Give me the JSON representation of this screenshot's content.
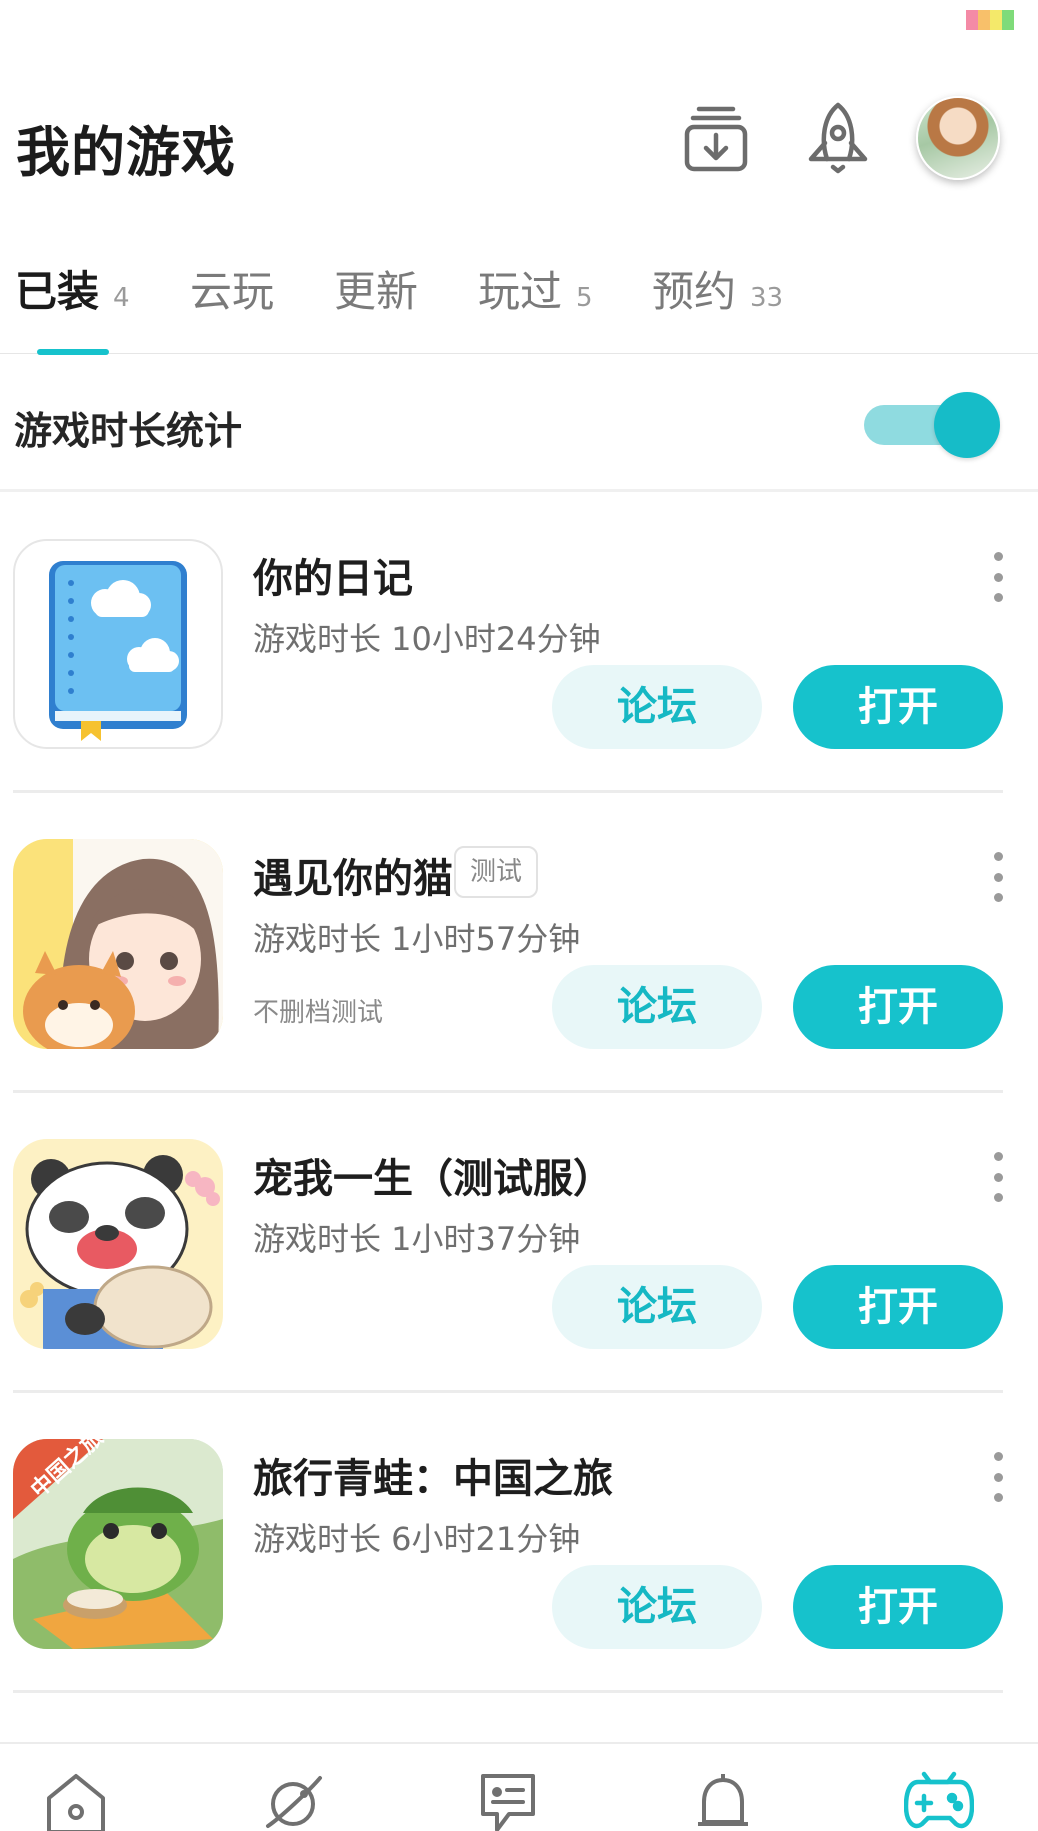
{
  "status_bar": {
    "colors": [
      "#f48aa6",
      "#f8c06a",
      "#f4e96a",
      "#7fdb7a"
    ]
  },
  "header": {
    "title": "我的游戏",
    "icons": [
      "download-box-icon",
      "rocket-icon",
      "avatar"
    ]
  },
  "tabs": [
    {
      "label": "已装",
      "count": "4",
      "active": true
    },
    {
      "label": "云玩",
      "count": ""
    },
    {
      "label": "更新",
      "count": ""
    },
    {
      "label": "玩过",
      "count": "5"
    },
    {
      "label": "预约",
      "count": "33"
    }
  ],
  "stats": {
    "label": "游戏时长统计",
    "toggle_on": true
  },
  "games": [
    {
      "name": "你的日记",
      "badge": "",
      "time": "游戏时长 10小时24分钟",
      "note": "",
      "forum_label": "论坛",
      "open_label": "打开"
    },
    {
      "name": "遇见你的猫",
      "badge": "测试",
      "time": "游戏时长 1小时57分钟",
      "note": "不删档测试",
      "forum_label": "论坛",
      "open_label": "打开"
    },
    {
      "name": "宠我一生（测试服）",
      "badge": "",
      "time": "游戏时长 1小时37分钟",
      "note": "",
      "forum_label": "论坛",
      "open_label": "打开"
    },
    {
      "name": "旅行青蛙：中国之旅",
      "badge": "",
      "time": "游戏时长 6小时21分钟",
      "note": "",
      "forum_label": "论坛",
      "open_label": "打开"
    }
  ],
  "bottom_nav": [
    {
      "icon": "home-icon"
    },
    {
      "icon": "planet-icon"
    },
    {
      "icon": "forum-chat-icon"
    },
    {
      "icon": "bell-icon"
    },
    {
      "icon": "gamepad-icon",
      "active": true
    }
  ],
  "colors": {
    "accent": "#16c2cc",
    "accent_light": "#e8f7f8",
    "nav_icon": "#707070"
  }
}
